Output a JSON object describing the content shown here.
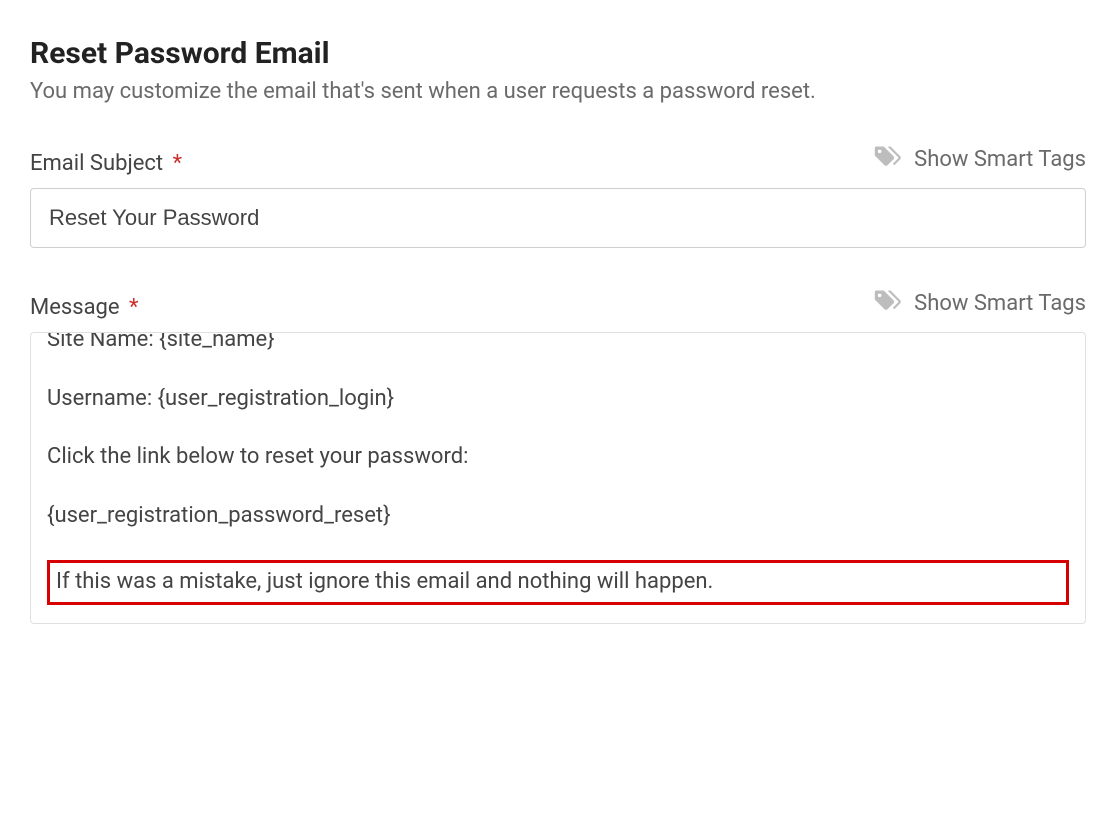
{
  "section": {
    "title": "Reset Password Email",
    "description": "You may customize the email that's sent when a user requests a password reset."
  },
  "labels": {
    "subject": "Email Subject",
    "message": "Message",
    "required_marker": "*",
    "show_smart_tags": "Show Smart Tags"
  },
  "icons": {
    "tags": "tags-icon"
  },
  "fields": {
    "subject_value": "Reset Your Password",
    "message_lines": {
      "l1": "Site Name: {site_name}",
      "l2": "Username: {user_registration_login}",
      "l3": "Click the link below to reset your password:",
      "l4": "{user_registration_password_reset}",
      "l5": "If this was a mistake, just ignore this email and nothing will happen."
    }
  }
}
